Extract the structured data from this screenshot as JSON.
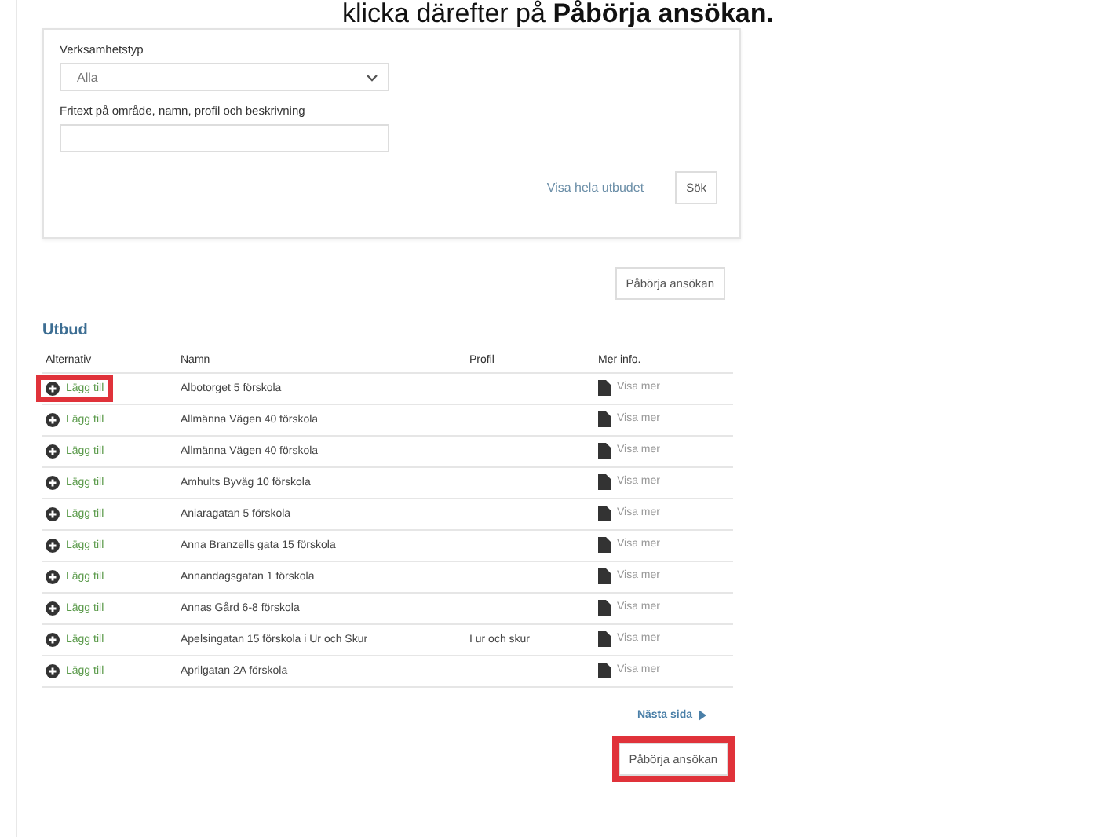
{
  "instruction": "klicka därefter på **Påbörja ansökan.**",
  "filter": {
    "type_label": "Verksamhetstyp",
    "type_value": "Alla",
    "text_label": "Fritext på område, namn, profil och beskrivning",
    "show_all_link": "Visa hela utbudet",
    "search_button": "Sök"
  },
  "top_button": {
    "label": "Påbörja ansökan",
    "highlighted": false
  },
  "section_title": "Utbud",
  "table": {
    "columns": [
      "Alternativ",
      "Namn",
      "Profil",
      "Mer info."
    ],
    "rows": [
      {
        "action": "Lägg till",
        "highlighted": true,
        "name": "Albotorget 5 förskola",
        "profile": "",
        "info": "Visa mer"
      },
      {
        "action": "Lägg till",
        "highlighted": false,
        "name": "Allmänna Vägen 40 förskola",
        "profile": "",
        "info": "Visa mer"
      },
      {
        "action": "Lägg till",
        "highlighted": false,
        "name": "Allmänna Vägen 40 förskola",
        "profile": "",
        "info": "Visa mer"
      },
      {
        "action": "Lägg till",
        "highlighted": false,
        "name": "Amhults Byväg 10 förskola",
        "profile": "",
        "info": "Visa mer"
      },
      {
        "action": "Lägg till",
        "highlighted": false,
        "name": "Aniaragatan 5 förskola",
        "profile": "",
        "info": "Visa mer"
      },
      {
        "action": "Lägg till",
        "highlighted": false,
        "name": "Anna Branzells gata 15 förskola",
        "profile": "",
        "info": "Visa mer"
      },
      {
        "action": "Lägg till",
        "highlighted": false,
        "name": "Annandagsgatan 1 förskola",
        "profile": "",
        "info": "Visa mer"
      },
      {
        "action": "Lägg till",
        "highlighted": false,
        "name": "Annas Gård 6-8 förskola",
        "profile": "",
        "info": "Visa mer"
      },
      {
        "action": "Lägg till",
        "highlighted": false,
        "name": "Apelsingatan 15 förskola i Ur och Skur",
        "profile": "I ur och skur",
        "info": "Visa mer"
      },
      {
        "action": "Lägg till",
        "highlighted": false,
        "name": "Aprilgatan 2A förskola",
        "profile": "",
        "info": "Visa mer"
      }
    ]
  },
  "next_page": "Nästa sida",
  "bottom_button": {
    "label": "Påbörja ansökan",
    "highlighted": true
  }
}
